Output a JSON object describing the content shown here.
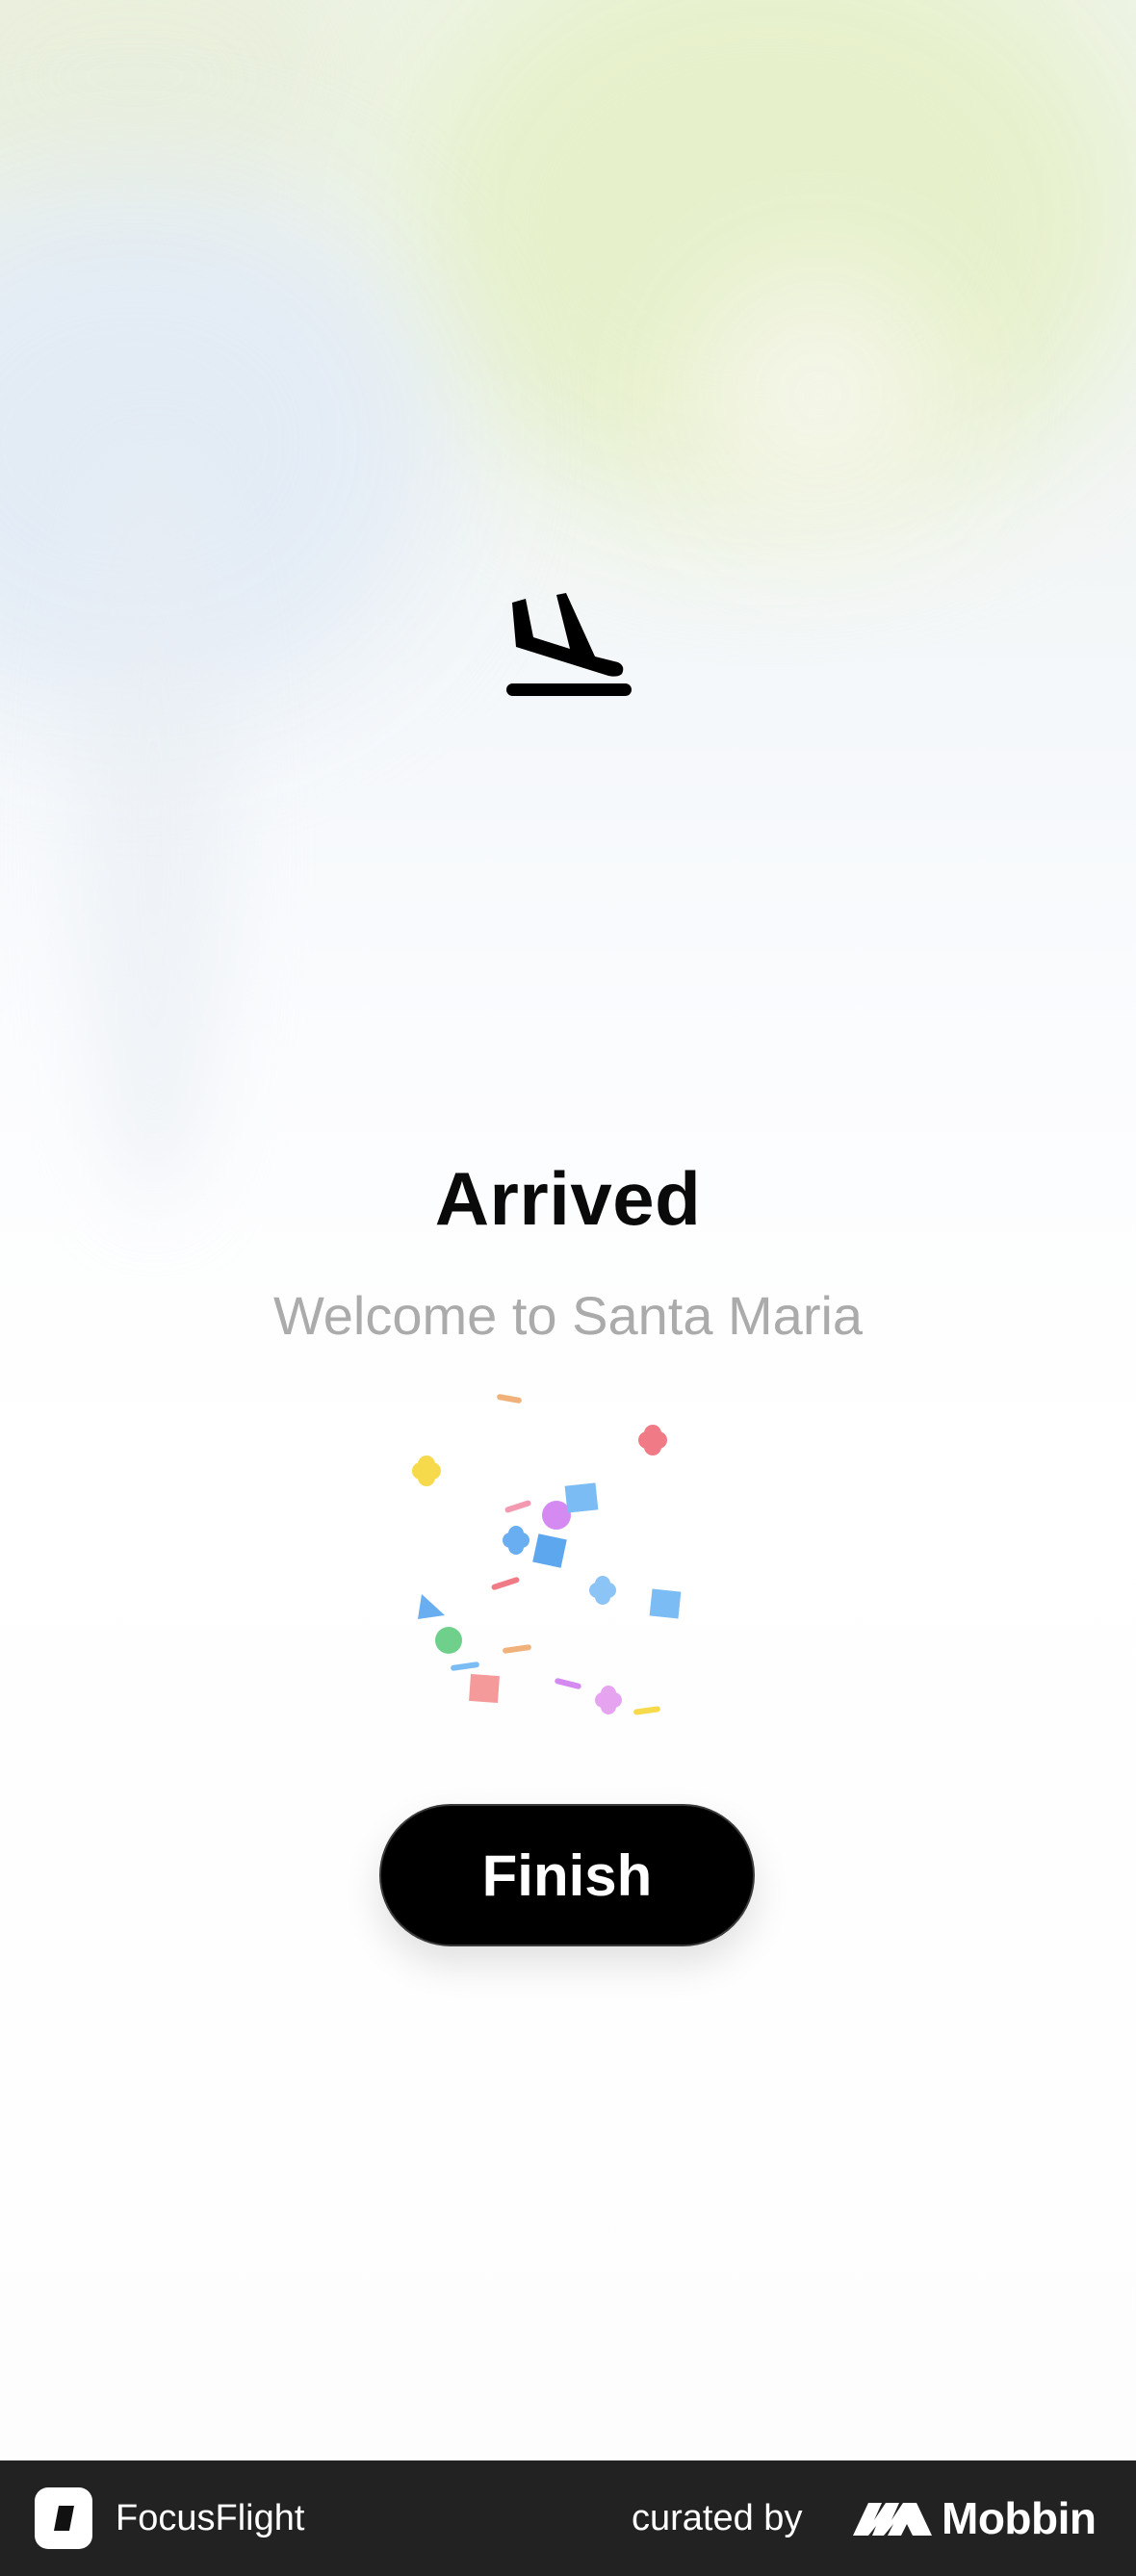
{
  "screen": {
    "title": "Arrived",
    "subtitle": "Welcome to Santa Maria",
    "finish_label": "Finish",
    "icons": {
      "status": "plane-landing-icon",
      "celebration": "confetti-icon"
    }
  },
  "footer": {
    "app_name": "FocusFlight",
    "curated_by": "curated by",
    "brand": "Mobbin"
  },
  "colors": {
    "button_background": "#000000",
    "button_text": "#ffffff",
    "title_text": "#0a0a0a",
    "subtitle_text": "#ababab",
    "footer_background": "#222222"
  }
}
